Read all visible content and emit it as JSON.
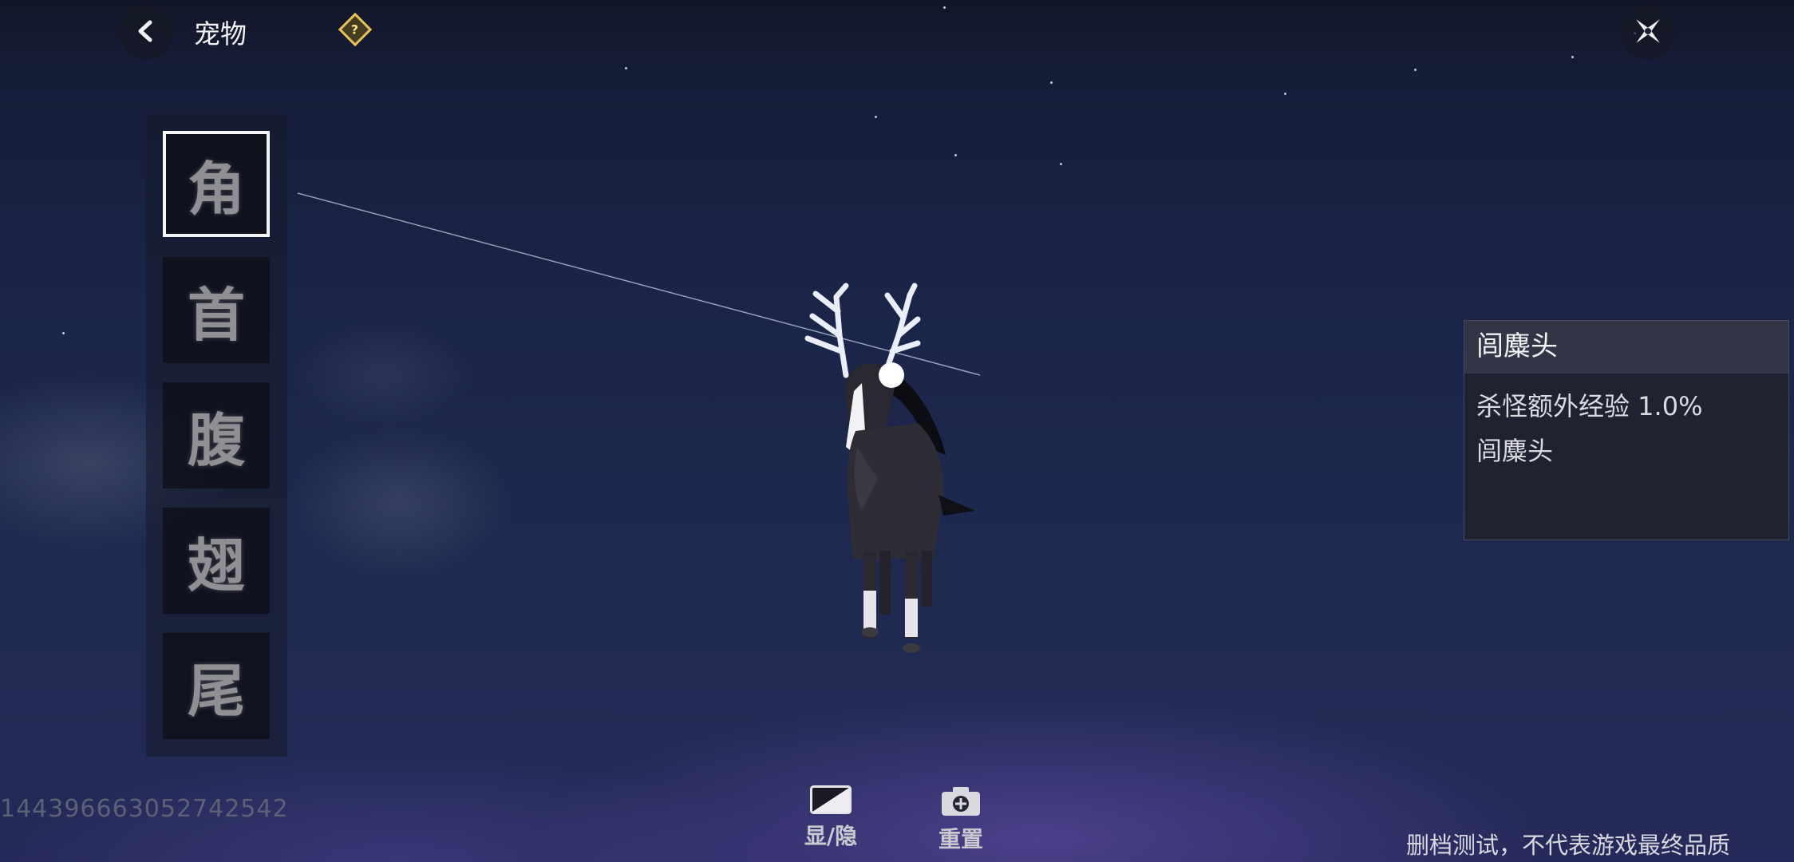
{
  "header": {
    "title": "宠物",
    "help_icon": "help-diamond-icon",
    "back_icon": "back-arrow-icon",
    "close_icon": "close-star-icon"
  },
  "parts": [
    {
      "label": "角",
      "selected": true
    },
    {
      "label": "首",
      "selected": false
    },
    {
      "label": "腹",
      "selected": false
    },
    {
      "label": "翅",
      "selected": false
    },
    {
      "label": "尾",
      "selected": false
    }
  ],
  "info_panel": {
    "title": "闾麋头",
    "lines": [
      "杀怪额外经验 1.0%",
      "闾麋头"
    ]
  },
  "bottom_tools": [
    {
      "label": "显/隐",
      "icon": "toggle-visibility-icon"
    },
    {
      "label": "重置",
      "icon": "camera-reset-icon"
    }
  ],
  "uid": "1443966630527425​42",
  "disclaimer": "删档测试，不代表游戏最终品质",
  "colors": {
    "accent_gold": "#e6c25a",
    "selected_border": "#f4f4f4"
  }
}
